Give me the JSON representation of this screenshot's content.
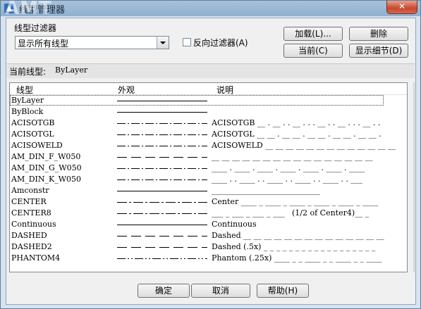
{
  "window": {
    "title": "线型管理器",
    "close_label": "✕",
    "watermark": "AMT"
  },
  "filter": {
    "label": "线型过滤器",
    "selected": "显示所有线型",
    "invert_label": "反向过滤器(A)",
    "invert_checked": false
  },
  "buttons": {
    "load": "加载(L)...",
    "delete": "删除",
    "current": "当前(C)",
    "show_details": "显示细节(D)",
    "ok": "确定",
    "cancel": "取消",
    "help": "帮助(H)"
  },
  "current_linetype": {
    "label": "当前线型:",
    "value": "ByLayer"
  },
  "table": {
    "columns": [
      "线型",
      "外观",
      "说明"
    ],
    "rows": [
      {
        "name": "ByLayer",
        "pattern": "solid",
        "desc": "",
        "selected": true
      },
      {
        "name": "ByBlock",
        "pattern": "solid",
        "desc": ""
      },
      {
        "name": "ACISOTGB",
        "pattern": "dashdot",
        "desc": "ACISOTGB __ . __ . . __ . . . __ . . __ . . . __ . ."
      },
      {
        "name": "ACISOTGL",
        "pattern": "dashdot",
        "desc": "ACISOTGL __ __ . __ __ . __ __ . __ __ . __ __ ."
      },
      {
        "name": "ACISOWELD",
        "pattern": "dashdot",
        "desc": "ACISOWELD __ __ __ __ __ __ __ __ __ __ __ __ __"
      },
      {
        "name": "AM_DIN_F_W050",
        "pattern": "dashed",
        "desc": "__ __ __ __ __ __ __ __ __ __ __ __ __ __ __ __"
      },
      {
        "name": "AM_DIN_G_W050",
        "pattern": "dashdot",
        "desc": "____ . ____ . ____ . ____ . ____ . ____ . ____"
      },
      {
        "name": "AM_DIN_K_W050",
        "pattern": "dashdot",
        "desc": "____ . . ____ . . ____ . . ____ . . ____ . . ___"
      },
      {
        "name": "Amconstr",
        "pattern": "solid",
        "desc": "____________________________"
      },
      {
        "name": "CENTER",
        "pattern": "center",
        "desc": "Center ____ _ ____ _ ____ _ ____ _ ____ _ ____"
      },
      {
        "name": "CENTER8",
        "pattern": "center",
        "desc": "___ _ ___ _ ___ _ ___   (1/2 of Center4)__ _"
      },
      {
        "name": "Continuous",
        "pattern": "solid",
        "desc": "Continuous"
      },
      {
        "name": "DASHED",
        "pattern": "dashed",
        "desc": "Dashed __ __ __ __ __ __ __ __ __ __ __ __ __ __"
      },
      {
        "name": "DASHED2",
        "pattern": "dashed",
        "desc": "Dashed (.5x) _ _ _ _ _ _ _ _ _ _ _ _ _ _ _ _ _ _"
      },
      {
        "name": "PHANTOM4",
        "pattern": "phantom",
        "desc": "Phantom (.25x) ____ _ _ ____ _ _ ____ _ _ ____"
      }
    ]
  }
}
